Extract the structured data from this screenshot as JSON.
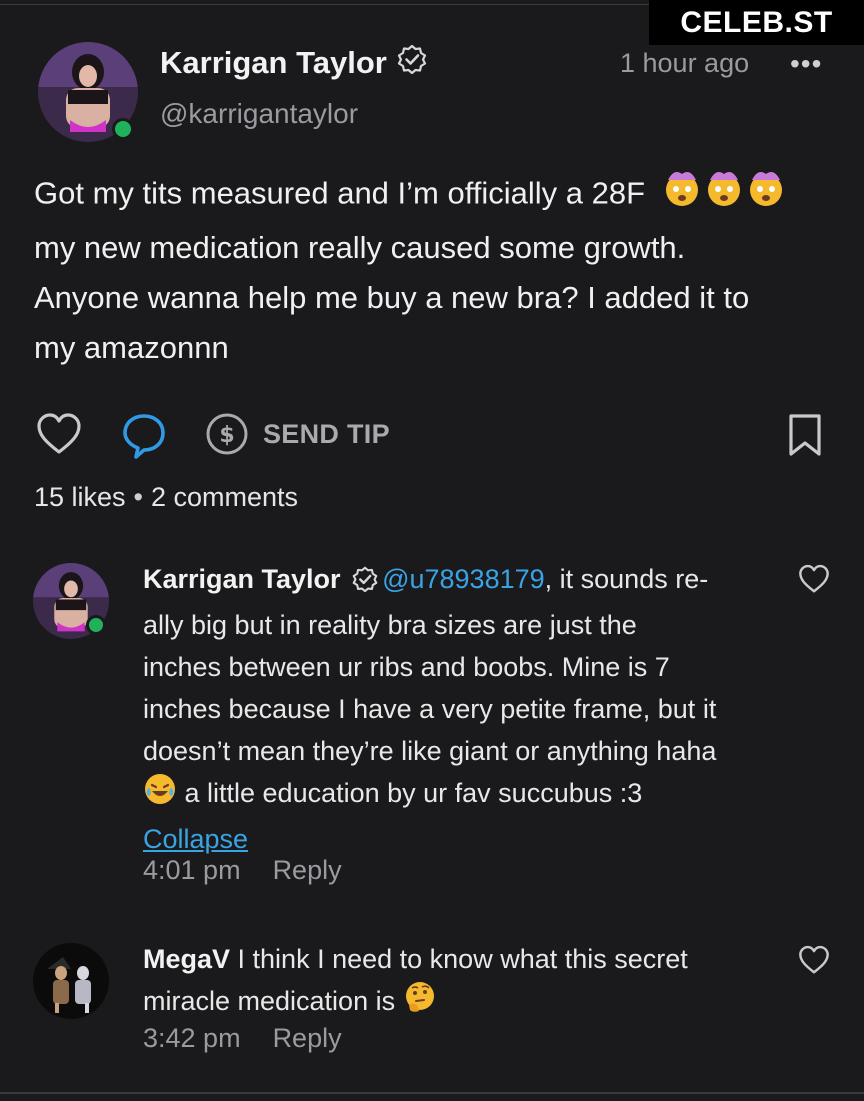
{
  "watermark": "CELEB.ST",
  "post": {
    "author_name": "Karrigan Taylor",
    "author_handle": "@karrigantaylor",
    "time_ago": "1 hour ago",
    "more_label": "•••",
    "text_lines": [
      "Got my tits measured and I’m officially a 28F",
      "my new medication really caused some growth.",
      "Anyone wanna help me buy a new bra? I added it to",
      "my amazonnn"
    ],
    "send_tip_label": "SEND TIP",
    "likes_label": "15 likes",
    "separator": "•",
    "comments_label": "2 comments"
  },
  "comments": [
    {
      "author": "Karrigan Taylor",
      "mention": "@u78938179",
      "text_first": ", it sounds re-",
      "text_lines": [
        "ally big but in reality bra sizes are just the",
        "inches between ur ribs and boobs. Mine is 7",
        "inches because I have a very petite frame, but it",
        "doesn’t mean they’re like giant or anything haha"
      ],
      "text_last": " a little education by ur fav succubus :3",
      "collapse_label": "Collapse",
      "time": "4:01 pm",
      "reply_label": "Reply"
    },
    {
      "author": "MegaV",
      "text_first": " I think I need to know what this secret",
      "text_last": "miracle medication is ",
      "time": "3:42 pm",
      "reply_label": "Reply"
    }
  ],
  "icons": {
    "like": "heart-icon",
    "comment": "comment-bubble-icon",
    "tip": "dollar-coin-icon",
    "bookmark": "bookmark-icon",
    "verified": "verified-badge-icon",
    "emoji_exploding": "exploding-head-emoji",
    "emoji_laugh": "laughing-tears-emoji",
    "emoji_thinking": "thinking-face-emoji"
  },
  "colors": {
    "background": "#1a1a1c",
    "link": "#3aa3e3",
    "online": "#1fb25a",
    "muted": "#9a9aa0"
  }
}
